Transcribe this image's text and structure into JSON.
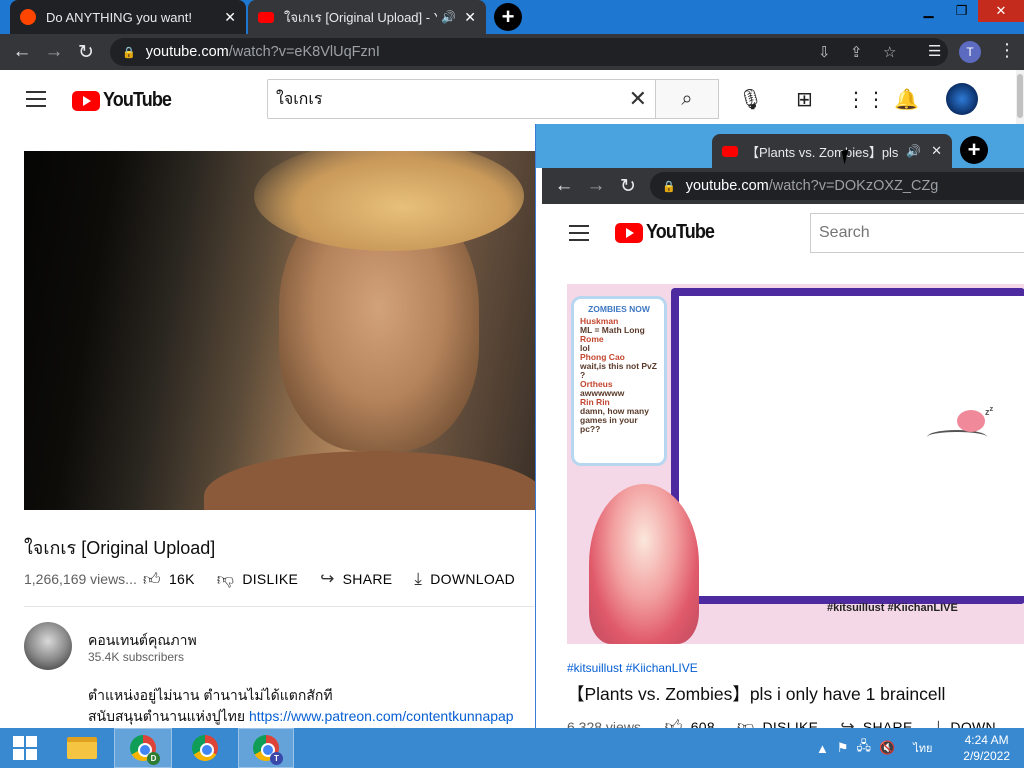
{
  "browser": {
    "tabs": [
      {
        "title": "Do ANYTHING you want!",
        "favicon": "reddit-icon"
      },
      {
        "title": "ใจเกเร [Original Upload] - You",
        "favicon": "youtube-icon",
        "audio": "speaker-icon"
      }
    ],
    "url": {
      "host": "youtube.com",
      "path": "/watch?v=eK8VlUqFznI"
    },
    "profile_initial": "T"
  },
  "youtube": {
    "logo_text": "YouTube",
    "search_value": "ใจเกเร",
    "video": {
      "title": "ใจเกเร [Original Upload]",
      "views": "1,266,169 views...",
      "likes": "16K",
      "dislike_label": "DISLIKE",
      "share_label": "SHARE",
      "download_label": "DOWNLOAD"
    },
    "channel": {
      "name": "คอนเทนต์คุณภาพ",
      "subscribers": "35.4K subscribers"
    },
    "description": {
      "line1": "ตำแหน่งอยู่ไม่นาน ตำนานไม่ได้แตกสักที",
      "line2_prefix": "สนับสนุนตำนานแห่งปูไทย ",
      "link": "https://www.patreon.com/contentkunnapap"
    }
  },
  "window2": {
    "tab_title": "【Plants vs. Zombies】pls i only",
    "url": {
      "host": "youtube.com",
      "path": "/watch?v=DOKzOXZ_CZg"
    },
    "logo_text": "YouTube",
    "search_placeholder": "Search",
    "stream": {
      "chat_header": "ZOMBIES NOW",
      "chat": [
        {
          "name": "Huskman",
          "msg": "ML = Math Long"
        },
        {
          "name": "Rome",
          "msg": "lol"
        },
        {
          "name": "Phong Cao",
          "msg": "wait,is this not PvZ ?"
        },
        {
          "name": "Ortheus",
          "msg": "awwwwww"
        },
        {
          "name": "Rin Rin",
          "msg": "damn, how many games in your pc??"
        }
      ],
      "hashtags_overlay": "#kitsuillust #KiichanLIVE"
    },
    "hashtags": "#kitsuillust #KiichanLIVE",
    "title": "【Plants vs. Zombies】pls i only have 1 braincell",
    "views": "6,328 views...",
    "likes": "608",
    "dislike_label": "DISLIKE",
    "share_label": "SHARE",
    "download_label": "DOWN"
  },
  "taskbar": {
    "time": "4:24 AM",
    "date": "2/9/2022",
    "language": "ไทย",
    "chrome_badges": [
      "D",
      "",
      "T"
    ]
  }
}
